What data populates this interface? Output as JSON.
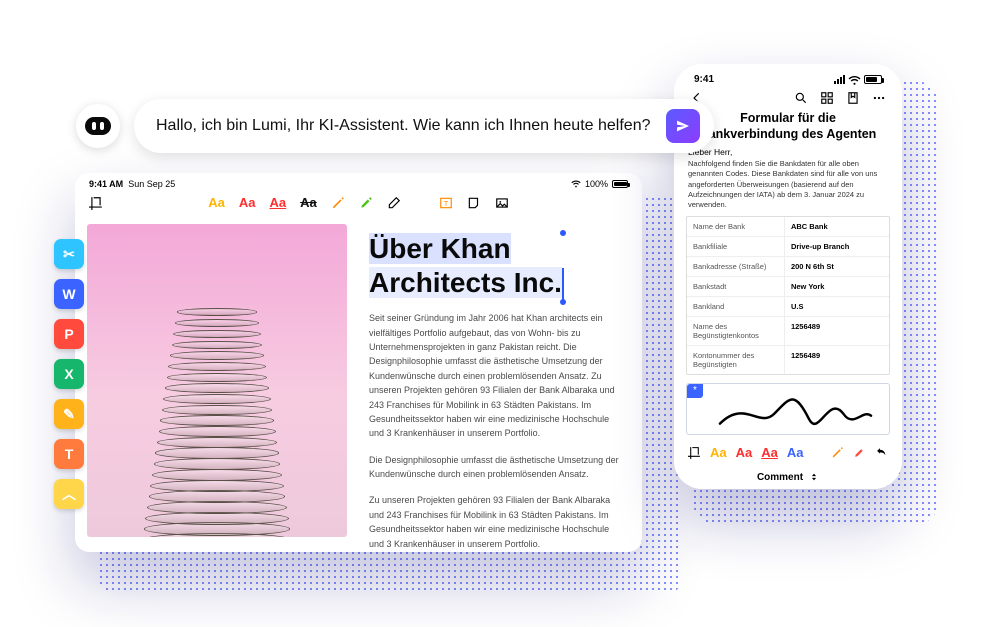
{
  "ai": {
    "text": "Hallo, ich bin Lumi, Ihr KI-Assistent. Wie kann ich Ihnen heute helfen?"
  },
  "side_apps": [
    {
      "name": "scissors",
      "color": "#2ec4ff",
      "glyph": "✂"
    },
    {
      "name": "word",
      "color": "#3a63ff",
      "glyph": "W"
    },
    {
      "name": "powerpoint",
      "color": "#ff4a3d",
      "glyph": "P"
    },
    {
      "name": "excel",
      "color": "#16b66c",
      "glyph": "X"
    },
    {
      "name": "edit",
      "color": "#ffb21a",
      "glyph": "✎"
    },
    {
      "name": "text",
      "color": "#ff7a3d",
      "glyph": "T"
    },
    {
      "name": "collapse",
      "color": "#ffd54a",
      "glyph": "︿"
    }
  ],
  "tablet": {
    "status": {
      "time": "9:41 AM",
      "date": "Sun Sep 25",
      "battery": "100%"
    },
    "toolbar": {
      "hl_colors": [
        "#ffb400",
        "#ff2d2d",
        "#ff2d2d",
        "#111111"
      ]
    },
    "title_l1": "Über Khan",
    "title_l2": "Architects Inc.",
    "p1": "Seit seiner Gründung im Jahr 2006 hat Khan architects ein vielfältiges Portfolio aufgebaut, das von Wohn- bis zu Unternehmensprojekten in ganz Pakistan reicht. Die Designphilosophie umfasst die ästhetische Umsetzung der Kundenwünsche durch einen problemlösenden Ansatz. Zu unseren Projekten gehören 93 Filialen der Bank Albaraka und 243 Franchises für Mobilink in 63 Städten Pakistans. Im Gesundheitssektor haben wir eine medizinische Hochschule und 3 Krankenhäuser in unserem Portfolio.",
    "p2": "Die Designphilosophie umfasst die ästhetische Umsetzung der Kundenwünsche durch einen problemlösenden Ansatz.",
    "p3": "Zu unseren Projekten gehören 93 Filialen der Bank Albaraka und 243 Franchises für Mobilink in 63 Städten Pakistans. Im Gesundheitssektor haben wir eine medizinische Hochschule und 3 Krankenhäuser in unserem Portfolio."
  },
  "phone": {
    "status_time": "9:41",
    "title": "Formular für die Bankverbindung des Agenten",
    "greet": "Lieber Herr,",
    "intro": "Nachfolgend finden Sie die Bankdaten für alle oben genannten Codes. Diese Bankdaten sind für alle von uns angeforderten Überweisungen (basierend auf den Aufzeichnungen der IATA) ab dem 3. Januar 2024 zu verwenden.",
    "rows": [
      {
        "l": "Name der Bank",
        "r": "ABC Bank"
      },
      {
        "l": "Bankfiliale",
        "r": "Drive-up Branch"
      },
      {
        "l": "Bankadresse (Straße)",
        "r": "200 N 6th St"
      },
      {
        "l": "Bankstadt",
        "r": "New York"
      },
      {
        "l": "Bankland",
        "r": "U.S"
      },
      {
        "l": "Name des Begünstigtenkontos",
        "r": "1256489"
      },
      {
        "l": "Kontonummer des Begünstigten",
        "r": "1256489"
      }
    ],
    "sig_tag": "*",
    "tool_colors": [
      "#ffb400",
      "#ff2d2d",
      "#ff2d2d",
      "#3a63ff"
    ],
    "comment": "Comment"
  }
}
